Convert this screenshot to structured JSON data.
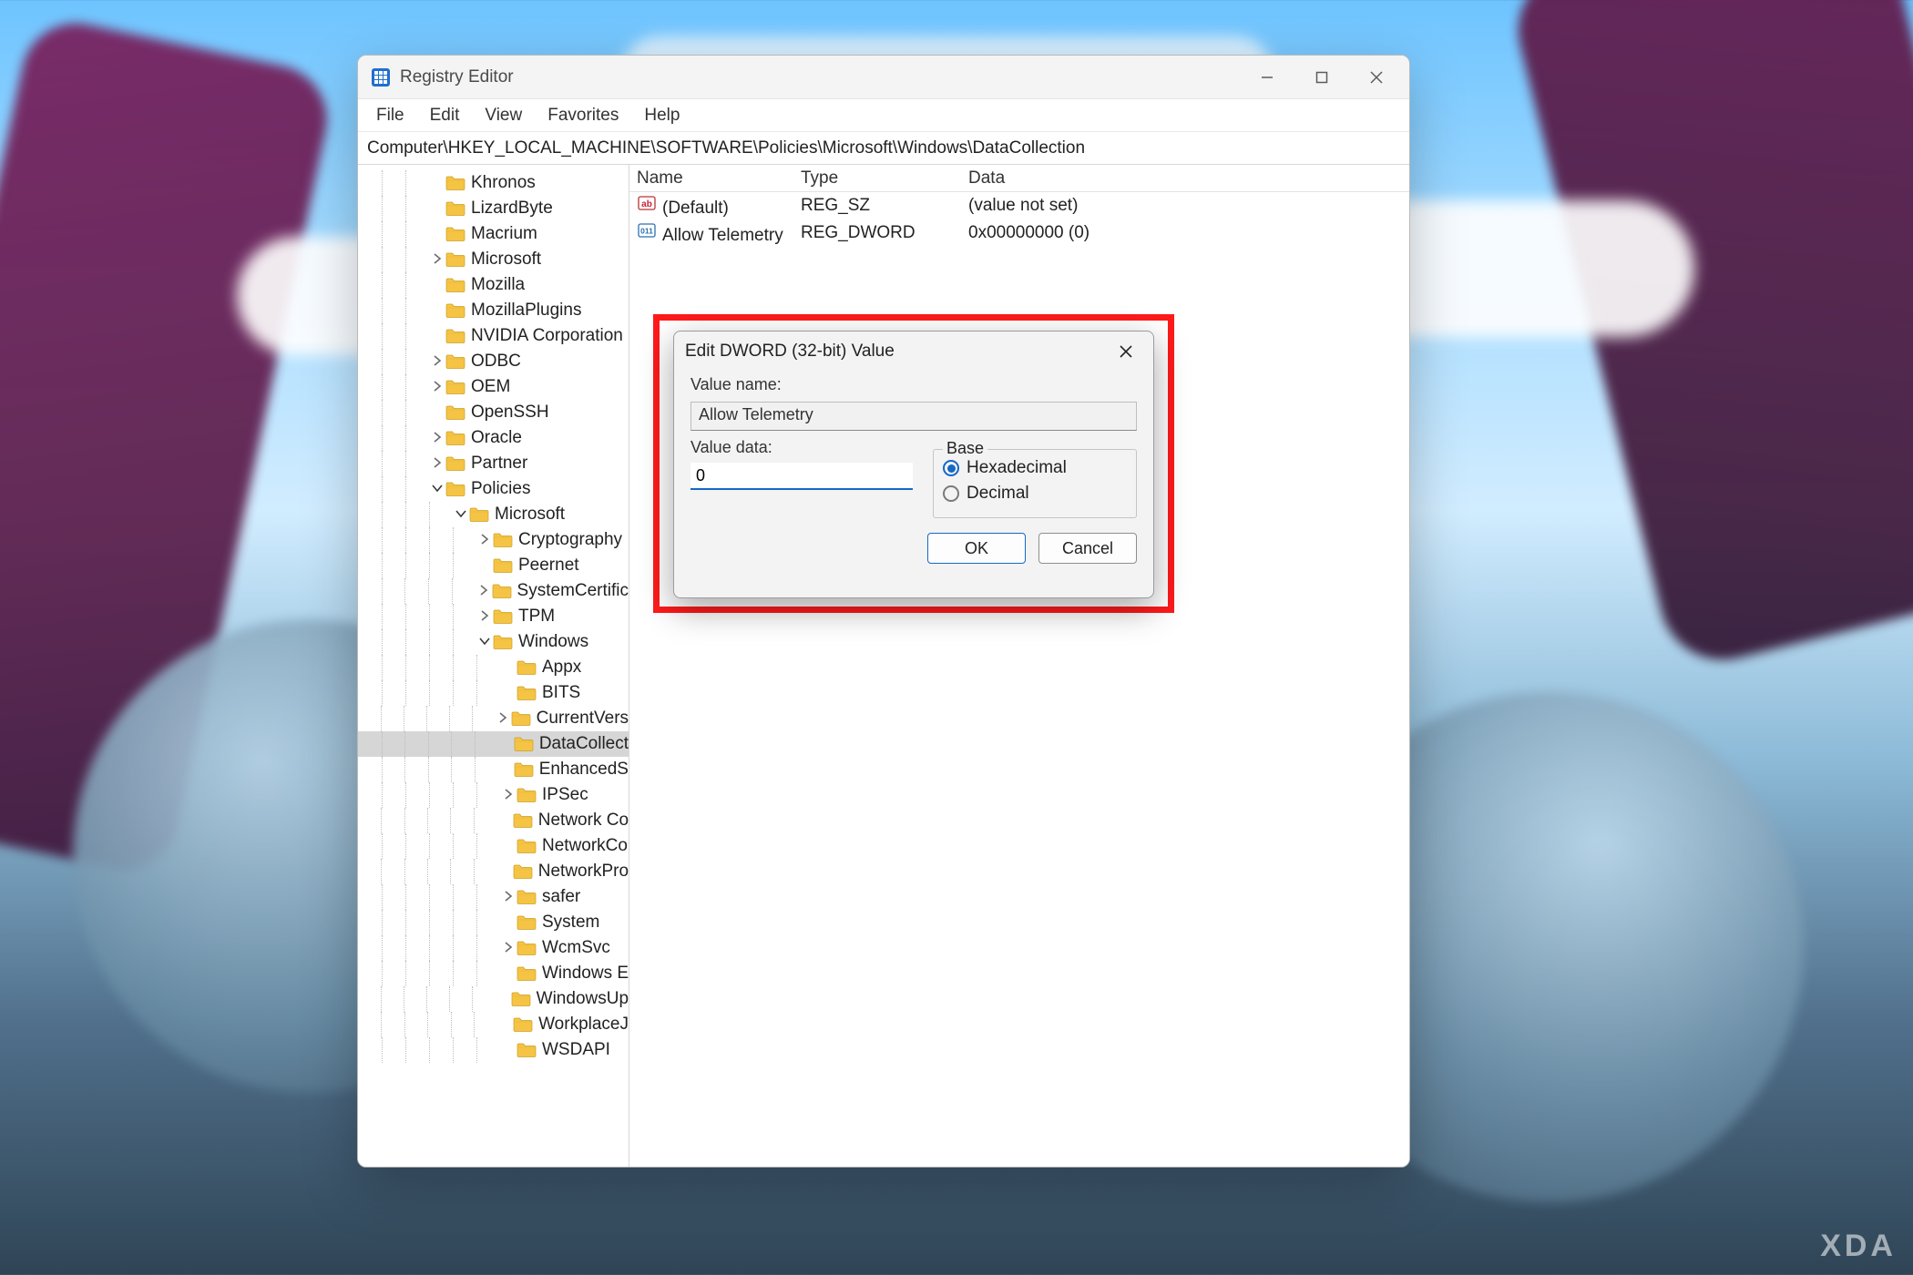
{
  "window": {
    "title": "Registry Editor",
    "menus": [
      "File",
      "Edit",
      "View",
      "Favorites",
      "Help"
    ],
    "address": "Computer\\HKEY_LOCAL_MACHINE\\SOFTWARE\\Policies\\Microsoft\\Windows\\DataCollection"
  },
  "tree": [
    {
      "depth": 3,
      "tw": "",
      "label": "Khronos"
    },
    {
      "depth": 3,
      "tw": "",
      "label": "LizardByte"
    },
    {
      "depth": 3,
      "tw": "",
      "label": "Macrium"
    },
    {
      "depth": 3,
      "tw": ">",
      "label": "Microsoft"
    },
    {
      "depth": 3,
      "tw": "",
      "label": "Mozilla"
    },
    {
      "depth": 3,
      "tw": "",
      "label": "MozillaPlugins"
    },
    {
      "depth": 3,
      "tw": "",
      "label": "NVIDIA Corporation"
    },
    {
      "depth": 3,
      "tw": ">",
      "label": "ODBC"
    },
    {
      "depth": 3,
      "tw": ">",
      "label": "OEM"
    },
    {
      "depth": 3,
      "tw": "",
      "label": "OpenSSH"
    },
    {
      "depth": 3,
      "tw": ">",
      "label": "Oracle"
    },
    {
      "depth": 3,
      "tw": ">",
      "label": "Partner"
    },
    {
      "depth": 3,
      "tw": "v",
      "label": "Policies"
    },
    {
      "depth": 4,
      "tw": "v",
      "label": "Microsoft"
    },
    {
      "depth": 5,
      "tw": ">",
      "label": "Cryptography"
    },
    {
      "depth": 5,
      "tw": "",
      "label": "Peernet"
    },
    {
      "depth": 5,
      "tw": ">",
      "label": "SystemCertific"
    },
    {
      "depth": 5,
      "tw": ">",
      "label": "TPM"
    },
    {
      "depth": 5,
      "tw": "v",
      "label": "Windows"
    },
    {
      "depth": 6,
      "tw": "",
      "label": "Appx"
    },
    {
      "depth": 6,
      "tw": "",
      "label": "BITS"
    },
    {
      "depth": 6,
      "tw": ">",
      "label": "CurrentVers"
    },
    {
      "depth": 6,
      "tw": "",
      "label": "DataCollect",
      "selected": true
    },
    {
      "depth": 6,
      "tw": "",
      "label": "EnhancedS"
    },
    {
      "depth": 6,
      "tw": ">",
      "label": "IPSec"
    },
    {
      "depth": 6,
      "tw": "",
      "label": "Network Co"
    },
    {
      "depth": 6,
      "tw": "",
      "label": "NetworkCo"
    },
    {
      "depth": 6,
      "tw": "",
      "label": "NetworkPro"
    },
    {
      "depth": 6,
      "tw": ">",
      "label": "safer"
    },
    {
      "depth": 6,
      "tw": "",
      "label": "System"
    },
    {
      "depth": 6,
      "tw": ">",
      "label": "WcmSvc"
    },
    {
      "depth": 6,
      "tw": "",
      "label": "Windows E"
    },
    {
      "depth": 6,
      "tw": "",
      "label": "WindowsUp"
    },
    {
      "depth": 6,
      "tw": "",
      "label": "WorkplaceJ"
    },
    {
      "depth": 6,
      "tw": "",
      "label": "WSDAPI"
    }
  ],
  "list": {
    "headers": {
      "name": "Name",
      "type": "Type",
      "data": "Data"
    },
    "rows": [
      {
        "icon": "sz",
        "name": "(Default)",
        "type": "REG_SZ",
        "data": "(value not set)"
      },
      {
        "icon": "dw",
        "name": "Allow Telemetry",
        "type": "REG_DWORD",
        "data": "0x00000000 (0)"
      }
    ]
  },
  "dialog": {
    "title": "Edit DWORD (32-bit) Value",
    "valueNameLabel": "Value name:",
    "valueName": "Allow Telemetry",
    "valueDataLabel": "Value data:",
    "valueData": "0",
    "baseLabel": "Base",
    "hexLabel": "Hexadecimal",
    "decLabel": "Decimal",
    "baseSelected": "hex",
    "ok": "OK",
    "cancel": "Cancel"
  },
  "watermark": "XDA"
}
